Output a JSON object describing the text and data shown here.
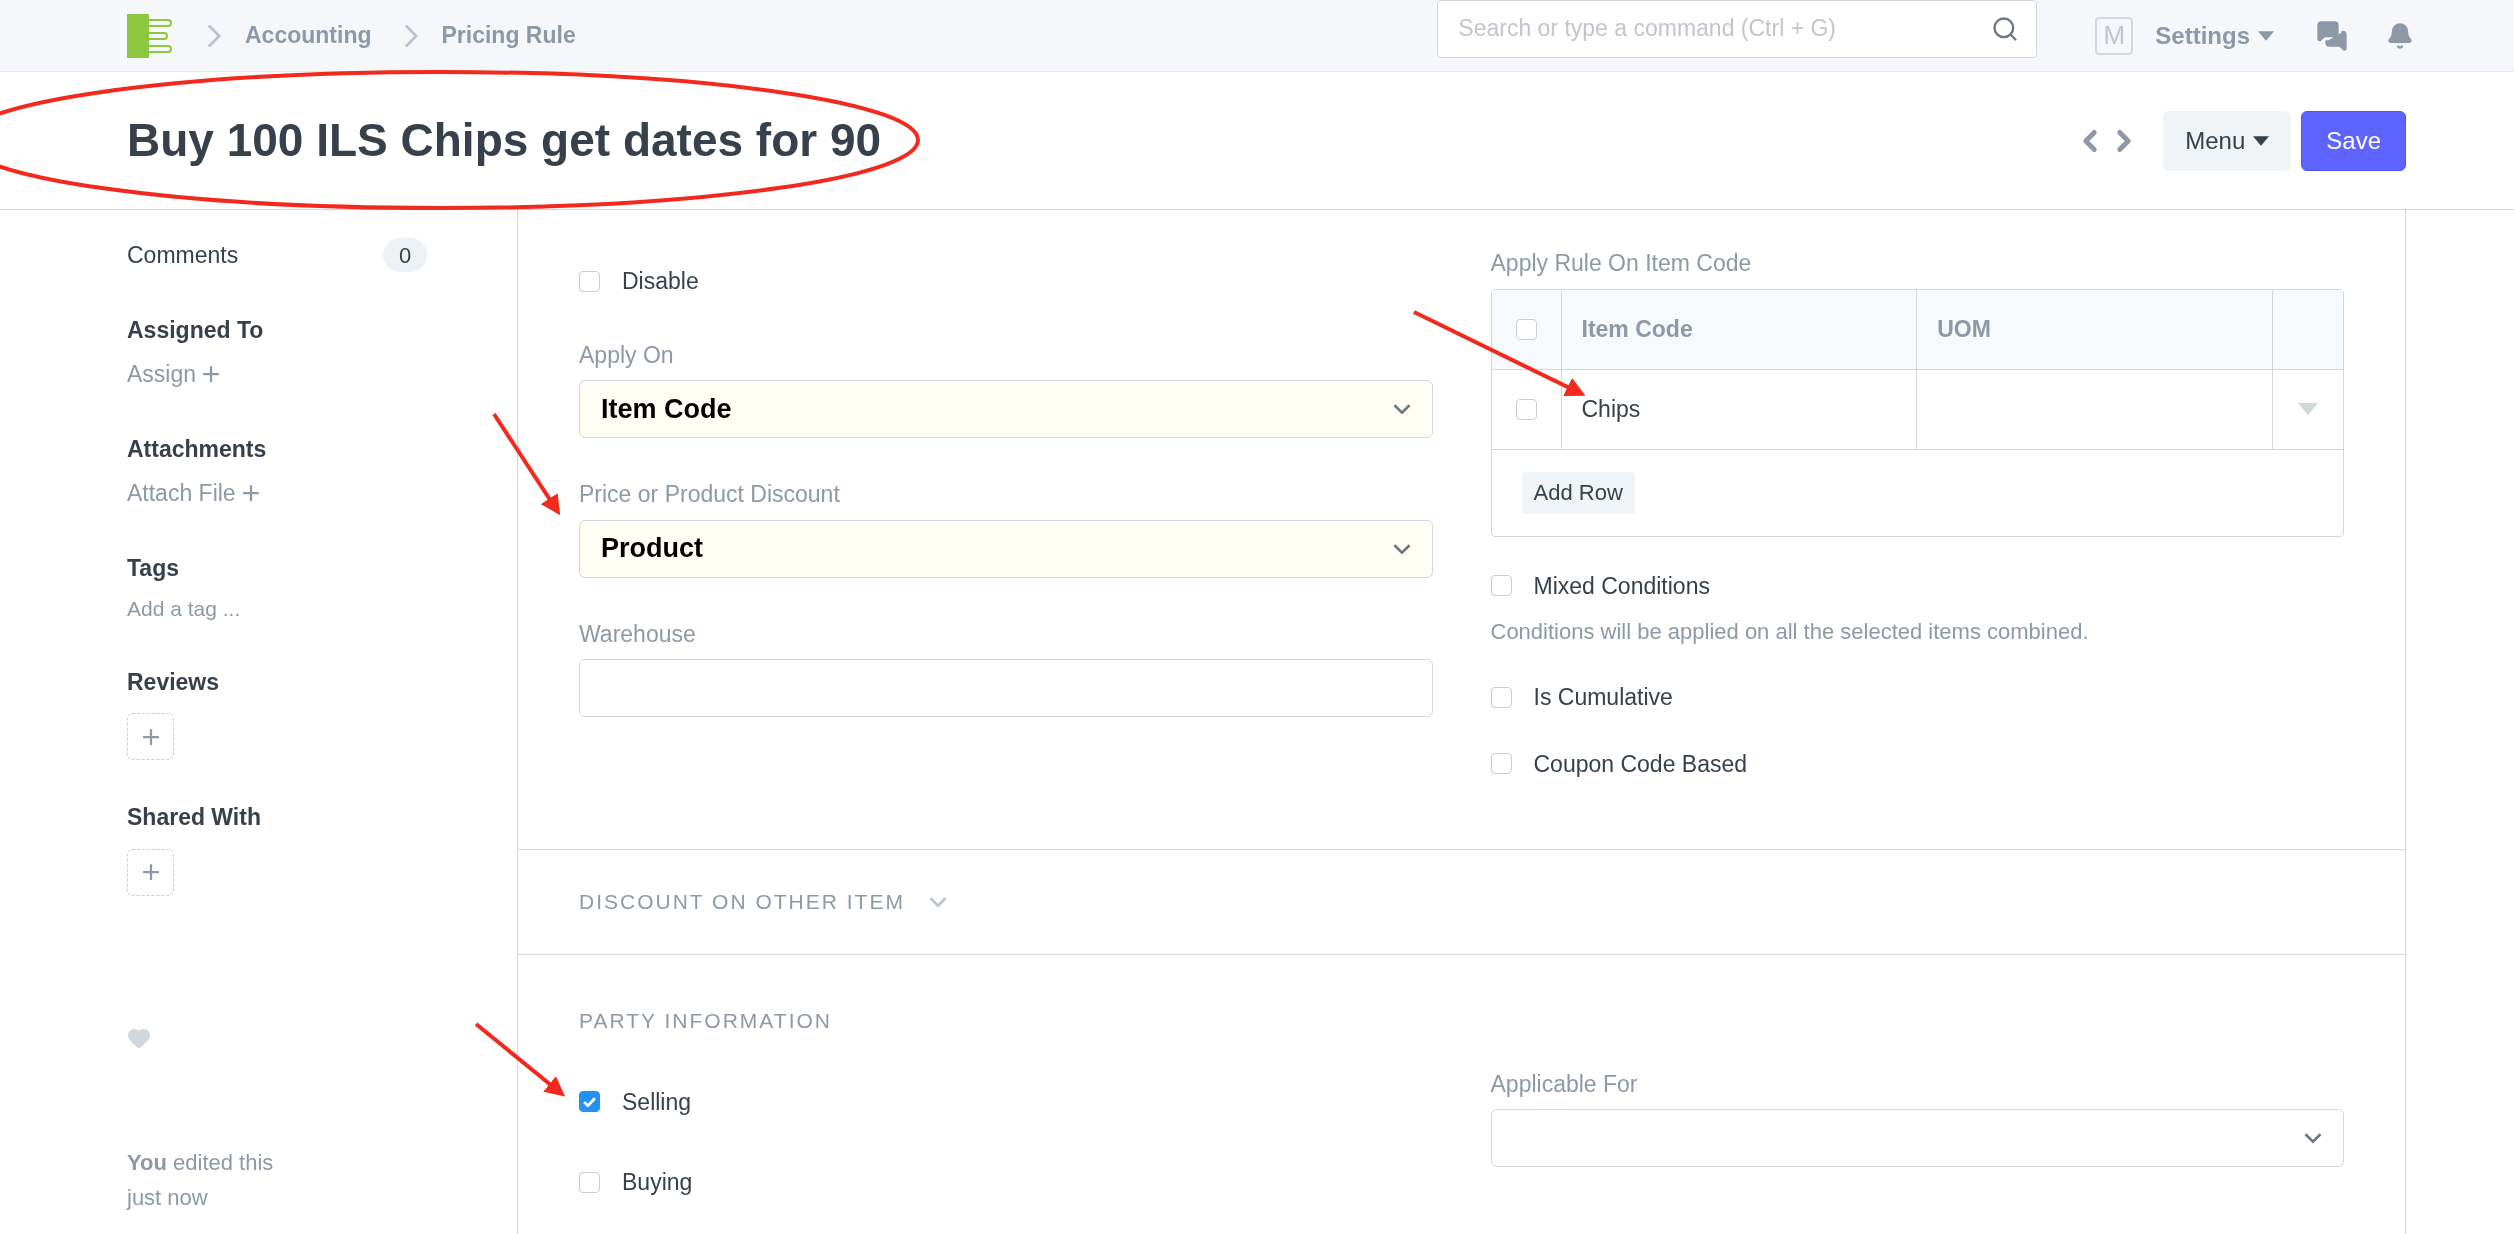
{
  "navbar": {
    "breadcrumbs": [
      "Accounting",
      "Pricing Rule"
    ],
    "search": {
      "placeholder": "Search or type a command (Ctrl + G)"
    },
    "avatar": "M",
    "settings": "Settings"
  },
  "header": {
    "title": "Buy 100 ILS Chips get dates for 90",
    "menu": "Menu",
    "save": "Save"
  },
  "sidebar": {
    "comments": {
      "label": "Comments",
      "count": "0"
    },
    "sections": [
      {
        "kind": "action",
        "title": "Assigned To",
        "action": "Assign"
      },
      {
        "kind": "action",
        "title": "Attachments",
        "action": "Attach File"
      },
      {
        "kind": "tags",
        "title": "Tags",
        "placeholder": "Add a tag ..."
      },
      {
        "kind": "add",
        "title": "Reviews"
      },
      {
        "kind": "add",
        "title": "Shared With"
      }
    ],
    "activity": "**You** edited this just now"
  },
  "form": {
    "left": [
      {
        "kind": "checkbox",
        "label": "Disable",
        "checked": false
      },
      {
        "kind": "select",
        "label": "Apply On",
        "value": "Item Code"
      },
      {
        "kind": "select",
        "label": "Price or Product Discount",
        "value": "Product"
      },
      {
        "kind": "input",
        "label": "Warehouse"
      }
    ],
    "table": {
      "label": "Apply Rule On Item Code",
      "header_checked": false,
      "columns": [
        "Item Code",
        "UOM"
      ],
      "rows": [
        {
          "checked": false,
          "item_code": "Chips"
        }
      ],
      "add_row": "Add Row"
    },
    "right": [
      {
        "label": "Mixed Conditions",
        "checked": false,
        "description": "Conditions will be applied on all the selected items combined."
      },
      {
        "label": "Is Cumulative",
        "checked": false
      },
      {
        "label": "Coupon Code Based",
        "checked": false
      }
    ]
  },
  "collapsed_section": {
    "title": "DISCOUNT ON OTHER ITEM",
    "expanded": false
  },
  "party": {
    "title": "PARTY INFORMATION",
    "checks": [
      {
        "label": "Selling",
        "checked": true
      },
      {
        "label": "Buying",
        "checked": false
      }
    ],
    "applicable_for": {
      "label": "Applicable For"
    }
  }
}
